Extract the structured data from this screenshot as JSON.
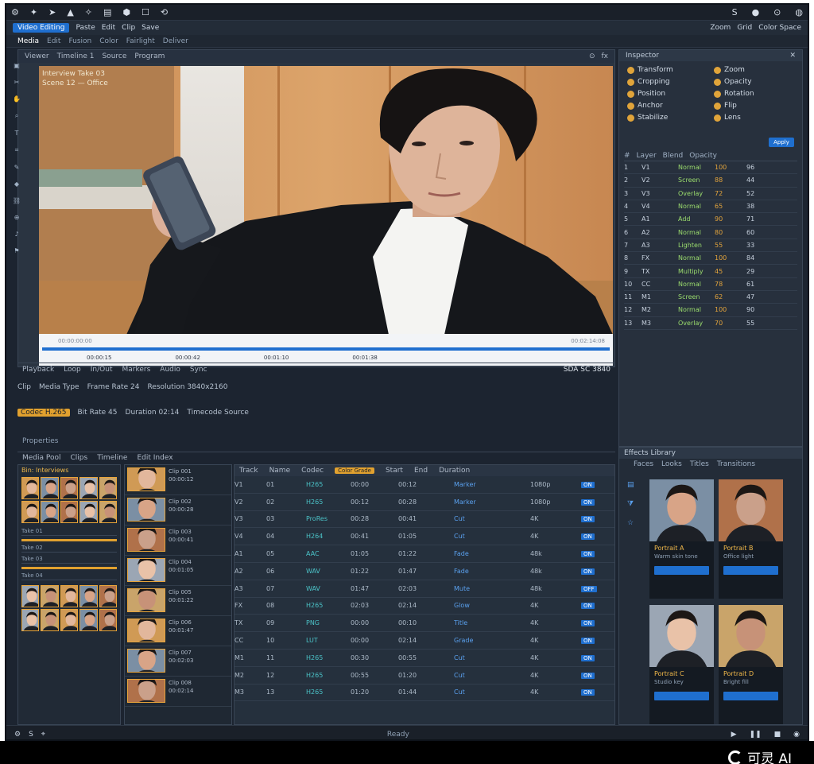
{
  "menubar": {
    "items": [
      "⚙",
      "✦",
      "➤",
      "▲",
      "✧",
      "▤",
      "⬢",
      "☐",
      "⟲"
    ],
    "right": [
      "S",
      "●",
      "⊙",
      "◍"
    ]
  },
  "toolbar": {
    "selected": "Video Editing",
    "items": [
      "Paste",
      "Edit",
      "Clip",
      "Save"
    ],
    "right": [
      "Zoom",
      "Grid",
      "Color Space"
    ]
  },
  "tabs": [
    "Media",
    "Edit",
    "Fusion",
    "Color",
    "Fairlight",
    "Deliver"
  ],
  "viewer": {
    "header": [
      "Viewer",
      "Timeline 1",
      "Source",
      "Program"
    ],
    "header_right": [
      "⊙",
      "fx"
    ],
    "overlay_lines": [
      "Interview Take 03",
      "Scene 12 — Office"
    ],
    "scrub_hint_left": "00:00:00:00",
    "scrub_hint_right": "00:02:14:08",
    "scrub_labels": [
      "00:00:15",
      "00:00:42",
      "00:01:10",
      "00:01:38"
    ]
  },
  "transport": {
    "items": [
      "Playback",
      "Loop",
      "In/Out",
      "Markers",
      "Audio",
      "Sync"
    ],
    "right": "SDA  SC 3840"
  },
  "info_rows": [
    {
      "items": [
        "Clip",
        "Media Type",
        "Frame Rate 24",
        "Resolution 3840x2160"
      ]
    },
    {
      "chip": "Codec H.265",
      "items": [
        "Bit Rate 45",
        "Duration 02:14",
        "Timecode Source"
      ]
    }
  ],
  "section_label": "Properties",
  "rpanel": {
    "title": "Inspector",
    "props": [
      "Transform",
      "Zoom",
      "Cropping",
      "Opacity",
      "Position",
      "Rotation",
      "Anchor",
      "Flip",
      "Stabilize",
      "Lens"
    ],
    "apply_label": "Apply",
    "table_headers": [
      "#",
      "Layer",
      "Blend",
      "Opacity"
    ],
    "rows": [
      [
        "1",
        "V1",
        "Normal",
        "100",
        "96"
      ],
      [
        "2",
        "V2",
        "Screen",
        "88",
        "44"
      ],
      [
        "3",
        "V3",
        "Overlay",
        "72",
        "52"
      ],
      [
        "4",
        "V4",
        "Normal",
        "65",
        "38"
      ],
      [
        "5",
        "A1",
        "Add",
        "90",
        "71"
      ],
      [
        "6",
        "A2",
        "Normal",
        "80",
        "60"
      ],
      [
        "7",
        "A3",
        "Lighten",
        "55",
        "33"
      ],
      [
        "8",
        "FX",
        "Normal",
        "100",
        "84"
      ],
      [
        "9",
        "TX",
        "Multiply",
        "45",
        "29"
      ],
      [
        "10",
        "CC",
        "Normal",
        "78",
        "61"
      ],
      [
        "11",
        "M1",
        "Screen",
        "62",
        "47"
      ],
      [
        "12",
        "M2",
        "Normal",
        "100",
        "90"
      ],
      [
        "13",
        "M3",
        "Overlay",
        "70",
        "55"
      ]
    ]
  },
  "rbpanel": {
    "title": "Effects Library",
    "subtabs": [
      "Faces",
      "Looks",
      "Titles",
      "Transitions"
    ],
    "cards": [
      {
        "name": "Portrait A",
        "line": "Warm skin tone"
      },
      {
        "name": "Portrait B",
        "line": "Office light"
      },
      {
        "name": "Portrait C",
        "line": "Studio key"
      },
      {
        "name": "Portrait D",
        "line": "Bright fill"
      }
    ]
  },
  "bottom": {
    "header": [
      "Media Pool",
      "Clips",
      "Timeline",
      "Edit Index"
    ],
    "media_label": "Bin: Interviews",
    "media_lines": [
      "Take 01",
      "Take 02",
      "Take 03",
      "Take 04"
    ],
    "clips": [
      {
        "line1": "Clip 001",
        "line2": "00:00:12"
      },
      {
        "line1": "Clip 002",
        "line2": "00:00:28"
      },
      {
        "line1": "Clip 003",
        "line2": "00:00:41"
      },
      {
        "line1": "Clip 004",
        "line2": "00:01:05"
      },
      {
        "line1": "Clip 005",
        "line2": "00:01:22"
      },
      {
        "line1": "Clip 006",
        "line2": "00:01:47"
      },
      {
        "line1": "Clip 007",
        "line2": "00:02:03"
      },
      {
        "line1": "Clip 008",
        "line2": "00:02:14"
      }
    ],
    "timeline_head": [
      "Track",
      "Name",
      "Codec",
      "Start",
      "End",
      "Duration"
    ],
    "timeline_chip": "Color Grade",
    "rows": [
      [
        "V1",
        "01",
        "H265",
        "00:00",
        "00:12",
        "Marker",
        "1080p",
        "ON"
      ],
      [
        "V2",
        "02",
        "H265",
        "00:12",
        "00:28",
        "Marker",
        "1080p",
        "ON"
      ],
      [
        "V3",
        "03",
        "ProRes",
        "00:28",
        "00:41",
        "Cut",
        "4K",
        "ON"
      ],
      [
        "V4",
        "04",
        "H264",
        "00:41",
        "01:05",
        "Cut",
        "4K",
        "ON"
      ],
      [
        "A1",
        "05",
        "AAC",
        "01:05",
        "01:22",
        "Fade",
        "48k",
        "ON"
      ],
      [
        "A2",
        "06",
        "WAV",
        "01:22",
        "01:47",
        "Fade",
        "48k",
        "ON"
      ],
      [
        "A3",
        "07",
        "WAV",
        "01:47",
        "02:03",
        "Mute",
        "48k",
        "OFF"
      ],
      [
        "FX",
        "08",
        "H265",
        "02:03",
        "02:14",
        "Glow",
        "4K",
        "ON"
      ],
      [
        "TX",
        "09",
        "PNG",
        "00:00",
        "00:10",
        "Title",
        "4K",
        "ON"
      ],
      [
        "CC",
        "10",
        "LUT",
        "00:00",
        "02:14",
        "Grade",
        "4K",
        "ON"
      ],
      [
        "M1",
        "11",
        "H265",
        "00:30",
        "00:55",
        "Cut",
        "4K",
        "ON"
      ],
      [
        "M2",
        "12",
        "H265",
        "00:55",
        "01:20",
        "Cut",
        "4K",
        "ON"
      ],
      [
        "M3",
        "13",
        "H265",
        "01:20",
        "01:44",
        "Cut",
        "4K",
        "ON"
      ]
    ]
  },
  "statusbar": {
    "left": [
      "⚙",
      "S",
      "⌖"
    ],
    "mid": "Ready",
    "right": [
      "▶",
      "❚❚",
      "■",
      "◉"
    ]
  },
  "watermark": "可灵 AI",
  "colors": {
    "accent": "#1f6fcf",
    "highlight": "#e1a12f",
    "panel": "#27303d"
  }
}
